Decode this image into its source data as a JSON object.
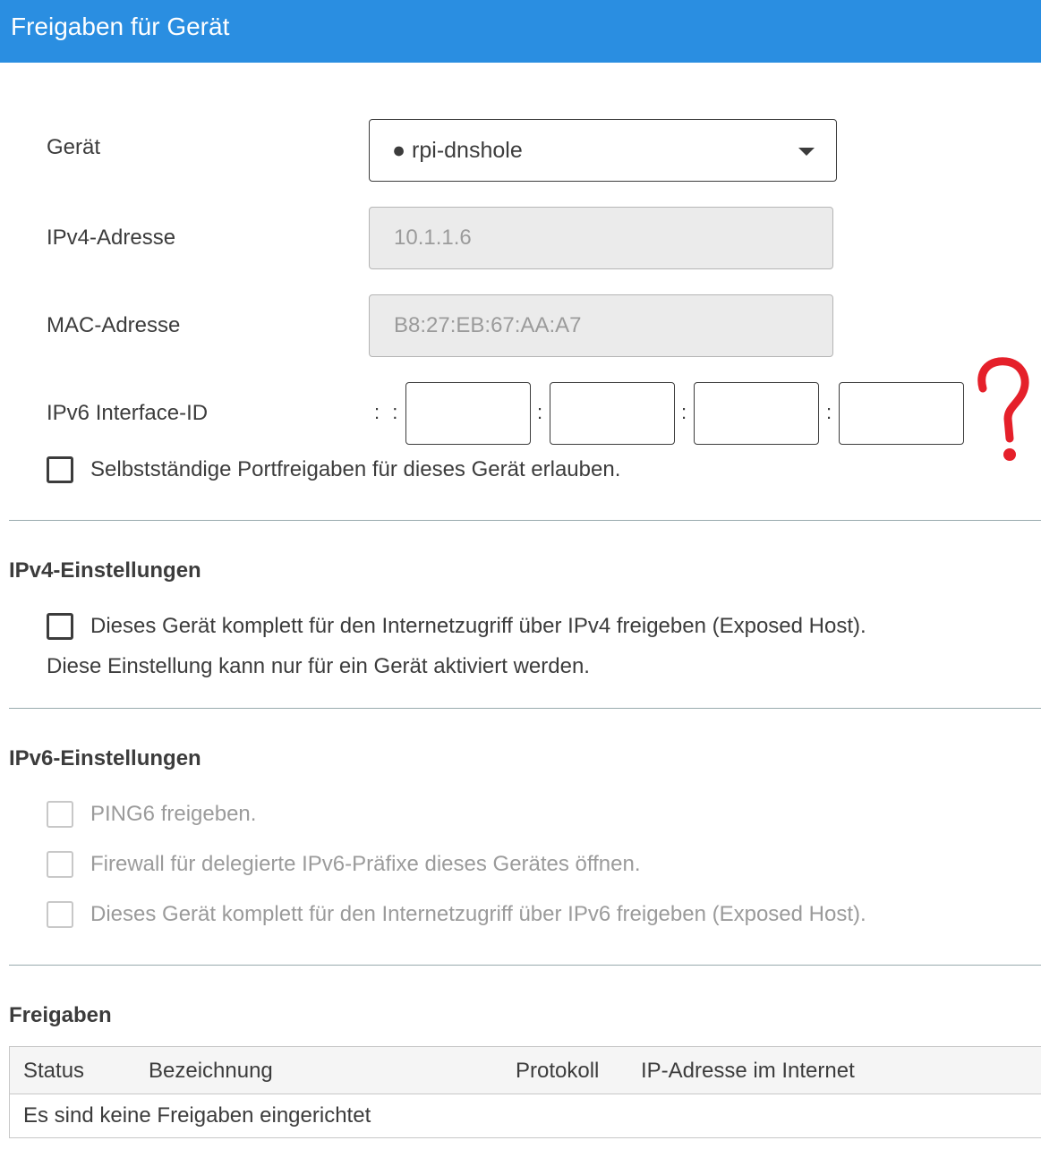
{
  "header": {
    "title": "Freigaben für Gerät"
  },
  "device": {
    "label": "Gerät",
    "selected": "● rpi-dnshole",
    "ipv4_label": "IPv4-Adresse",
    "ipv4_value": "10.1.1.6",
    "mac_label": "MAC-Adresse",
    "mac_value": "B8:27:EB:67:AA:A7",
    "ipv6_label": "IPv6 Interface-ID",
    "ipv6_prefix": ": :",
    "ipv6_sep": ":",
    "ipv6_groups": [
      "",
      "",
      "",
      ""
    ],
    "annotation": "?",
    "portfwd_checkbox": "Selbstständige Portfreigaben für dieses Gerät erlauben."
  },
  "ipv4_settings": {
    "title": "IPv4-Einstellungen",
    "exposed_host_checkbox": "Dieses Gerät komplett für den Internetzugriff über IPv4 freigeben (Exposed Host).",
    "note": "Diese Einstellung kann nur für ein Gerät aktiviert werden."
  },
  "ipv6_settings": {
    "title": "IPv6-Einstellungen",
    "ping6_checkbox": "PING6 freigeben.",
    "firewall_checkbox": "Firewall für delegierte IPv6-Präfixe dieses Gerätes öffnen.",
    "exposed_host_checkbox": "Dieses Gerät komplett für den Internetzugriff über IPv6 freigeben (Exposed Host)."
  },
  "shares": {
    "title": "Freigaben",
    "columns": [
      "Status",
      "Bezeichnung",
      "Protokoll",
      "IP-Adresse im Internet"
    ],
    "empty_message": "Es sind keine Freigaben eingerichtet"
  },
  "colors": {
    "header": "#2a8ee1",
    "annotation": "#e5202a"
  }
}
